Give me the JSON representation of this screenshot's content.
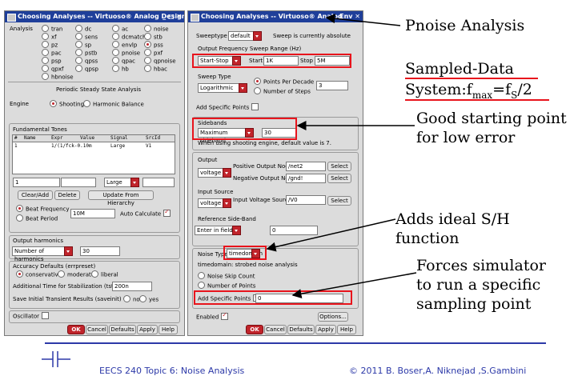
{
  "left_window": {
    "title": "Choosing Analyses -- Virtuoso® Analog Design Env",
    "window_buttons": "_ □ ✕",
    "analysis_label": "Analysis",
    "analyses": [
      "tran",
      "dc",
      "ac",
      "noise",
      "xf",
      "sens",
      "dcmatch",
      "stb",
      "pz",
      "sp",
      "envlp",
      "pss",
      "pac",
      "pstb",
      "pnoise",
      "pxf",
      "psp",
      "qpss",
      "qpac",
      "qpnoise",
      "qpxf",
      "qpsp",
      "hb",
      "hbac",
      "hbnoise"
    ],
    "selected_analysis": "pss",
    "section_title": "Periodic Steady State Analysis",
    "engine_label": "Engine",
    "engine_options": [
      "Shooting",
      "Harmonic Balance"
    ],
    "tones_title": "Fundamental Tones",
    "tones_headers": [
      "#",
      "Name",
      "Expr",
      "Value",
      "Signal",
      "SrcId"
    ],
    "tones_row": [
      "1",
      "",
      "1/(1/fck-0.10m",
      "",
      "Large",
      "V1"
    ],
    "tone_entry_index": "1",
    "signal_select": "Large",
    "clear_add": "Clear/Add",
    "delete": "Delete",
    "update_hierarchy": "Update From Hierarchy",
    "beat_frequency": "Beat Frequency",
    "beat_period": "Beat Period",
    "beat_value": "10M",
    "auto_calculate": "Auto Calculate",
    "output_harmonics_title": "Output harmonics",
    "number_of_harmonics": "Number of harmonics",
    "harmonics_value": "30",
    "accuracy_title": "Accuracy Defaults (errpreset)",
    "accuracy_options": [
      "conservative",
      "moderate",
      "liberal"
    ],
    "stabilization_label": "Additional Time for Stabilization (tstab)",
    "stabilization_value": "200n",
    "save_transient_label": "Save Initial Transient Results (saveinit)",
    "save_options": [
      "no",
      "yes"
    ],
    "oscillator_label": "Oscillator",
    "buttons": [
      "OK",
      "Cancel",
      "Defaults",
      "Apply",
      "Help"
    ]
  },
  "right_window": {
    "title": "Choosing Analyses -- Virtuoso® Analog",
    "window_buttons": "Env ✕",
    "sweeptype_label": "Sweeptype",
    "sweeptype_value": "default",
    "sweep_note": "Sweep is currently absolute",
    "freq_range_title": "Output Frequency Sweep Range (Hz)",
    "range_type": "Start-Stop",
    "start_label": "Start",
    "start_value": "1K",
    "stop_label": "Stop",
    "stop_value": "5M",
    "sweep_type_title": "Sweep Type",
    "sweep_type_value": "Logarithmic",
    "points_per_decade": "Points Per Decade",
    "points_value": "3",
    "number_of_steps": "Number of Steps",
    "add_specific_points": "Add Specific Points",
    "sidebands_title": "Sidebands",
    "sidebands_type": "Maximum sideband",
    "sidebands_value": "30",
    "sidebands_note": "When using shooting engine, default value is 7.",
    "output_title": "Output",
    "output_type": "voltage",
    "pos_node_label": "Positive Output Node",
    "pos_node_value": "/net2",
    "neg_node_label": "Negative Output Node",
    "neg_node_value": "/gnd!",
    "select": "Select",
    "input_title": "Input Source",
    "input_type": "voltage",
    "input_label": "Input Voltage Source",
    "input_value": "/V0",
    "ref_sideband_title": "Reference Side-Band",
    "ref_sideband_type": "Enter in field",
    "ref_sideband_value": "0",
    "noise_type_label": "Noise Type",
    "noise_type_value": "timedomain",
    "noise_note": "timedomain: strobed noise analysis",
    "noise_skip_count": "Noise Skip Count",
    "number_of_points": "Number of Points",
    "add_specific_points_2": "Add Specific Points",
    "add_points_value": "0",
    "enabled": "Enabled",
    "options": "Options...",
    "buttons": [
      "OK",
      "Cancel",
      "Defaults",
      "Apply",
      "Help"
    ]
  },
  "annotations": {
    "pnoise": "Pnoise Analysis",
    "sampled_line1": "Sampled-Data",
    "sampled_line2_a": "System:f",
    "sampled_line2_sub1": "max",
    "sampled_line2_b": "=f",
    "sampled_line2_sub2": "S",
    "sampled_line2_c": "/2",
    "good_start": "Good starting point",
    "good_start_2": "for low error",
    "ideal_sh": "Adds ideal S/H",
    "ideal_sh_2": "function",
    "forces": "Forces simulator",
    "forces_2": "to run a specific",
    "forces_3": "sampling point"
  },
  "footer": {
    "course": "EECS 240 Topic 6: Noise Analysis",
    "copyright": "© 2011  B. Boser,A. Niknejad ,S.Gambini"
  },
  "colors": {
    "title_bar": "#1f3f9a",
    "accent_red": "#e8141c",
    "footer_blue": "#2c39a8"
  }
}
